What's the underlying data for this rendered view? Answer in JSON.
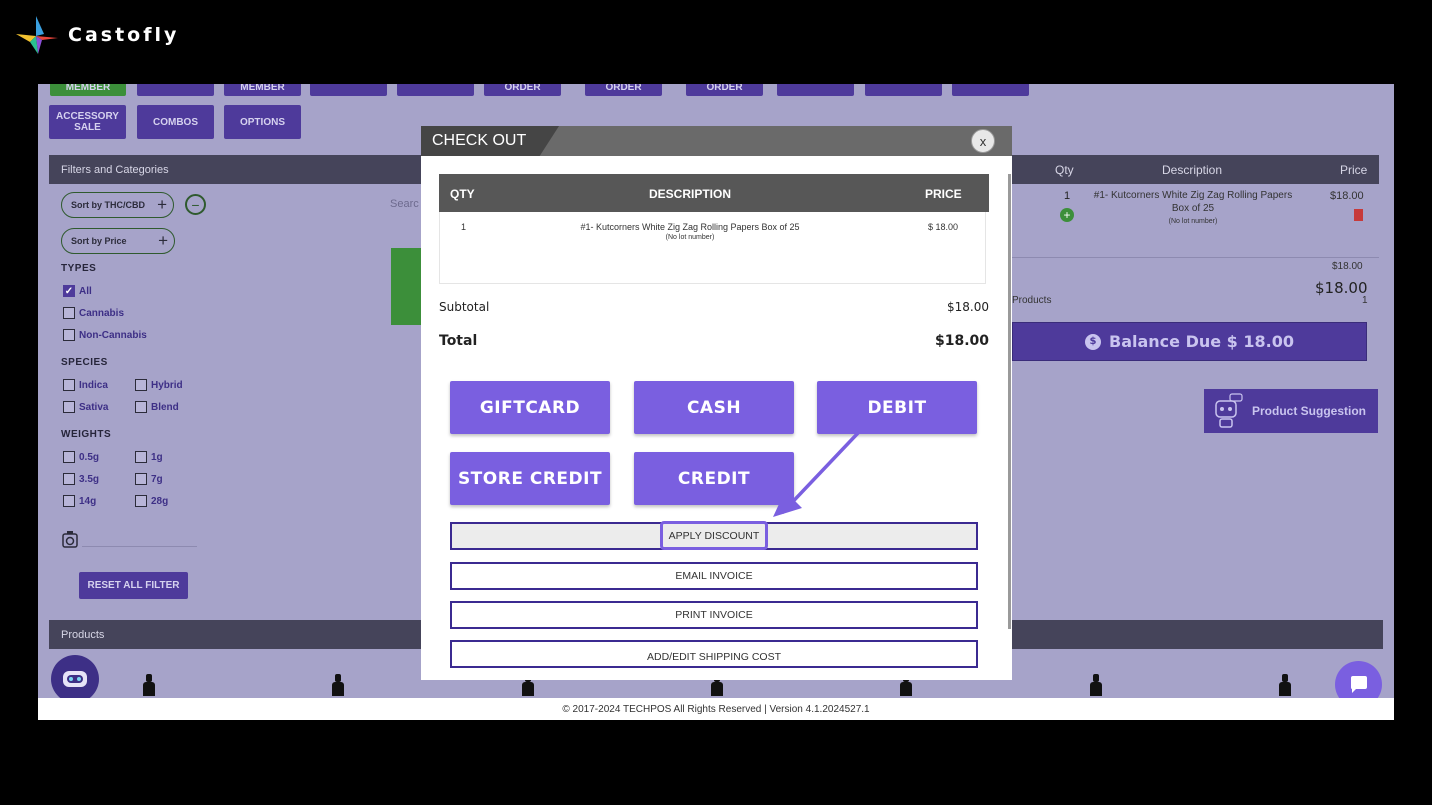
{
  "brand": {
    "name": "Castofly"
  },
  "colors": {
    "accent": "#7a5fe0",
    "primary_dark": "#4e3a9b",
    "header_gray": "#575757"
  },
  "top_buttons": {
    "row1": [
      "MEMBER",
      "",
      "MEMBER",
      "",
      "",
      "ORDER",
      "ORDER",
      "ORDER",
      "",
      "",
      ""
    ],
    "row2": [
      "ACCESSORY SALE",
      "COMBOS",
      "OPTIONS"
    ]
  },
  "filters": {
    "header": "Filters and Categories",
    "sort_thc": "Sort by THC/CBD",
    "sort_price": "Sort by Price",
    "search_placeholder": "Searc",
    "types_title": "TYPES",
    "types": [
      "All",
      "Cannabis",
      "Non-Cannabis"
    ],
    "species_title": "SPECIES",
    "species": [
      "Indica",
      "Hybrid",
      "Sativa",
      "Blend"
    ],
    "weights_title": "WEIGHTS",
    "weights": [
      "0.5g",
      "1g",
      "3.5g",
      "7g",
      "14g",
      "28g"
    ],
    "reset": "RESET ALL FILTER"
  },
  "products_header": "Products",
  "checkout": {
    "title": "CHECK OUT",
    "close": "x",
    "columns": {
      "qty": "QTY",
      "description": "DESCRIPTION",
      "price": "PRICE"
    },
    "row": {
      "qty": "1",
      "description": "#1- Kutcorners White Zig Zag Rolling Papers Box of 25",
      "lot": "(No lot number)",
      "price": "$ 18.00"
    },
    "subtotal_label": "Subtotal",
    "subtotal_value": "$18.00",
    "total_label": "Total",
    "total_value": "$18.00",
    "payments": [
      "GIFTCARD",
      "CASH",
      "DEBIT",
      "STORE CREDIT",
      "CREDIT"
    ],
    "options": [
      "APPLY DISCOUNT",
      "EMAIL INVOICE",
      "PRINT INVOICE",
      "ADD/EDIT SHIPPING COST"
    ]
  },
  "cart": {
    "columns": {
      "qty": "Qty",
      "description": "Description",
      "price": "Price"
    },
    "item": {
      "qty": "1",
      "description": "#1- Kutcorners White Zig Zag Rolling Papers Box of 25",
      "lot": "(No lot number)",
      "price": "$18.00"
    },
    "sub_small": "$18.00",
    "total_big": "$18.00",
    "products_label": "Products",
    "products_count": "1",
    "balance_due": "Balance Due $ 18.00",
    "product_suggestion": "Product Suggestion"
  },
  "footer": "© 2017-2024 TECHPOS All Rights Reserved | Version 4.1.2024527.1"
}
